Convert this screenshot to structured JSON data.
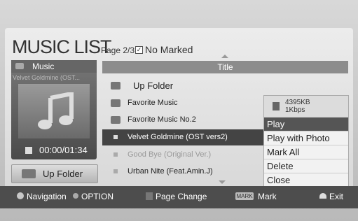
{
  "header": {
    "title": "MUSIC LIST",
    "page": "Page 2/3",
    "marked": "No Marked"
  },
  "preview": {
    "category": "Music",
    "track": "Velvet Goldmine (OST...",
    "time": "00:00/01:34",
    "up_folder_label": "Up Folder"
  },
  "list": {
    "column_title": "Title",
    "rows": [
      {
        "name": "Up Folder",
        "type": "folder"
      },
      {
        "name": "Favorite Music",
        "type": "folder"
      },
      {
        "name": "Favorite Music No.2",
        "type": "folder"
      },
      {
        "name": "Velvet Goldmine (OST vers2)",
        "type": "file",
        "selected": true
      },
      {
        "name": "Good Bye (Original Ver.)",
        "type": "file"
      },
      {
        "name": "Urban Nite (Feat.Amin.J)",
        "type": "file"
      }
    ]
  },
  "menu": {
    "size": "4395KB",
    "bitrate": "1Kbps",
    "items": [
      "Play",
      "Play with Photo",
      "Mark All",
      "Delete",
      "Close"
    ]
  },
  "footer": {
    "navigation": "Navigation",
    "option": "OPTION",
    "page_change": "Page Change",
    "mark_key": "MARK",
    "mark": "Mark",
    "exit": "Exit"
  }
}
